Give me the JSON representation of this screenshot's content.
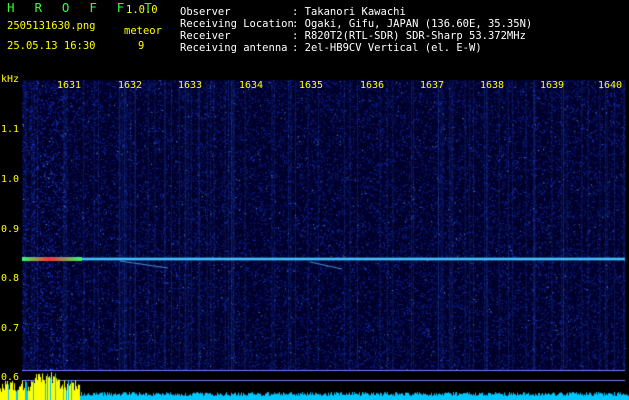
{
  "header": {
    "app_title": "H R O F F T",
    "version": "1.0.0",
    "filename": "2505131630.png",
    "datetime": "25.05.13 16:30",
    "meteor_label": "meteor",
    "meteor_count": "9",
    "info_labels": [
      "Observer",
      "Receiving Location",
      "Receiver",
      "Receiving antenna"
    ],
    "info_values": [
      ": Takanori Kawachi",
      ": Ogaki, Gifu, JAPAN (136.60E, 35.35N)",
      ": R820T2(RTL-SDR) SDR-Sharp 53.372MHz",
      ": 2el-HB9CV Vertical (el. E-W)"
    ]
  },
  "axes": {
    "y_unit": "kHz",
    "y_ticks": [
      "1.1",
      "1.0",
      "0.9",
      "0.8",
      "0.7",
      "0.6"
    ],
    "x_ticks": [
      "1631",
      "1632",
      "1633",
      "1634",
      "1635",
      "1636",
      "1637",
      "1638",
      "1639",
      "1640"
    ]
  },
  "colors": {
    "yellow": "#ffff00",
    "green": "#33ff33",
    "background": "#000000",
    "spectrum_base": "#00002a",
    "noise_blue": "#1a4cff",
    "carrier": "#40c0ff",
    "meteor_red": "#ff3030",
    "meteor_green": "#30ff60",
    "bar_cyan": "#00c8ff",
    "bar_yellow": "#ffff00"
  }
}
